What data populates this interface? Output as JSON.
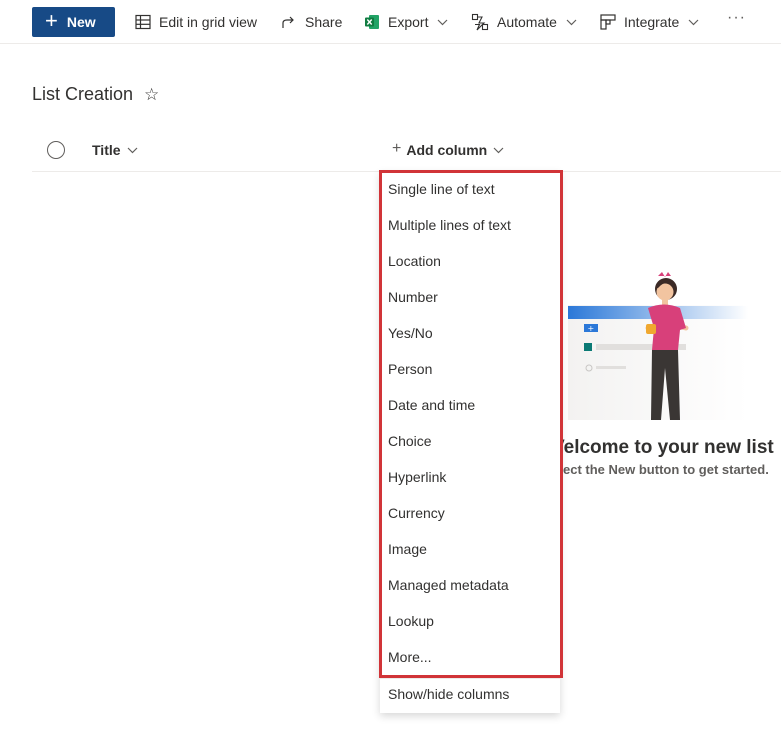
{
  "command_bar": {
    "new_label": "New",
    "edit_grid_label": "Edit in grid view",
    "share_label": "Share",
    "export_label": "Export",
    "automate_label": "Automate",
    "integrate_label": "Integrate",
    "more_label": "···"
  },
  "list": {
    "title": "List Creation",
    "favorite_icon": "☆"
  },
  "columns": {
    "title_label": "Title",
    "add_column_label": "Add column"
  },
  "add_column_menu": {
    "items": [
      "Single line of text",
      "Multiple lines of text",
      "Location",
      "Number",
      "Yes/No",
      "Person",
      "Date and time",
      "Choice",
      "Hyperlink",
      "Currency",
      "Image",
      "Managed metadata",
      "Lookup",
      "More..."
    ],
    "footer_item": "Show/hide columns",
    "highlight_color": "#d13438"
  },
  "empty_state": {
    "heading": "Velcome to your new list",
    "subtext": "ect the New button to get started."
  },
  "colors": {
    "primary": "#174a86",
    "text": "#323130",
    "border": "#edebe9"
  }
}
